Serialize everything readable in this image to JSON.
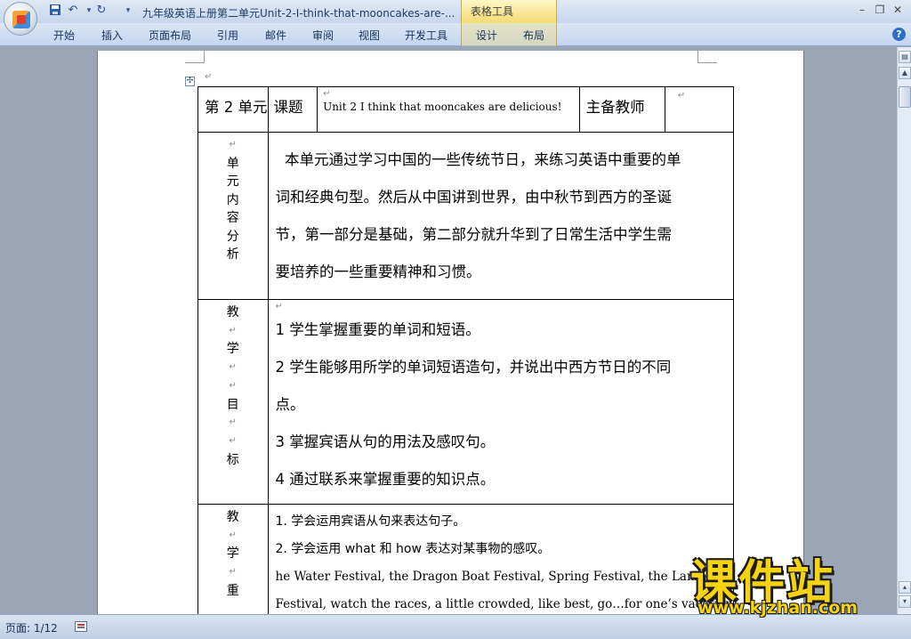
{
  "titlebar": {
    "doc_title": "九年级英语上册第二单元Unit-2-I-think-that-mooncakes-are-...",
    "context_tab_title": "表格工具",
    "quick_access": {
      "undo": "↶",
      "redo": "↻",
      "customize": "▾"
    },
    "window_buttons": {
      "minimize": "–",
      "restore": "❐",
      "close": "✕"
    }
  },
  "ribbon": {
    "tabs": [
      "开始",
      "插入",
      "页面布局",
      "引用",
      "邮件",
      "审阅",
      "视图",
      "开发工具",
      "设计",
      "布局"
    ],
    "help": "?"
  },
  "table": {
    "row1": {
      "unit": "第 2 单元",
      "topic_label": "课题",
      "topic_value": "Unit 2 I think that mooncakes are delicious!",
      "teacher_label": "主备教师"
    },
    "row2": {
      "label_chars": [
        "单",
        "元",
        "内",
        "容",
        "分",
        "析"
      ],
      "paragraph_lines": [
        "  本单元通过学习中国的一些传统节日，来练习英语中重要的单",
        "词和经典句型。然后从中国讲到世界，由中秋节到西方的圣诞",
        "节，第一部分是基础，第二部分就升华到了日常生活中学生需",
        "要培养的一些重要精神和习惯。"
      ]
    },
    "row3": {
      "label_chars": [
        "教",
        "学",
        "目",
        "标"
      ],
      "items": [
        "1 学生掌握重要的单词和短语。",
        "2  学生能够用所学的单词短语造句，并说出中西方节日的不同",
        "点。",
        "3 掌握宾语从句的用法及感叹句。",
        "4 通过联系来掌握重要的知识点。"
      ]
    },
    "row4": {
      "label_chars": [
        "教",
        "学",
        "重"
      ],
      "items": [
        "1. 学会运用宾语从句来表达句子。",
        "2. 学会运用 what 和 how 表达对某事物的感叹。",
        "he Water Festival, the Dragon Boat Festival, Spring Festival, the Lantern",
        "Festival, watch the races, a little crowded, like best, go…for one’s vacation"
      ]
    }
  },
  "statusbar": {
    "page": "页面: 1/12"
  },
  "watermark": {
    "main": "课件站",
    "url": "www.kjzhan.com"
  },
  "colors": {
    "ribbon": "#c3d5ee",
    "context_tab": "#f5dc72",
    "watermark": "#f6d311"
  }
}
